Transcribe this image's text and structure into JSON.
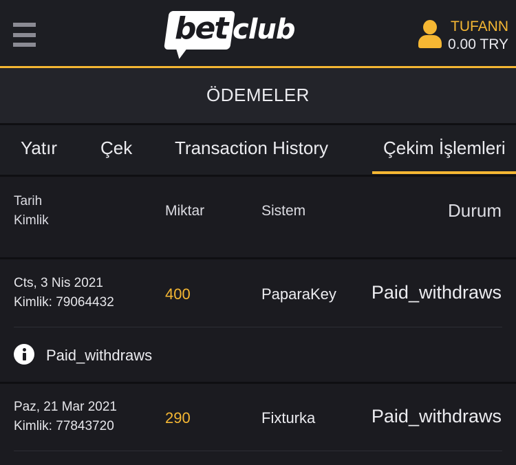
{
  "header": {
    "logo": {
      "part1": "bet",
      "part2": "club"
    },
    "username": "TUFANN",
    "balance": "0.00 TRY",
    "colors": {
      "accent": "#f5b733",
      "background": "#1b1b20"
    }
  },
  "page_title": "ÖDEMELER",
  "tabs": [
    {
      "label": "Yatır"
    },
    {
      "label": "Çek"
    },
    {
      "label": "Transaction History"
    },
    {
      "label": "Çekim İşlemleri",
      "active": true
    }
  ],
  "table": {
    "headers": {
      "date_line1": "Tarih",
      "date_line2": "Kimlik",
      "amount": "Miktar",
      "system": "Sistem",
      "status": "Durum"
    },
    "rows": [
      {
        "date": "Cts, 3 Nis 2021",
        "id": "Kimlik: 79064432",
        "amount": "400",
        "system": "PaparaKey",
        "status": "Paid_withdraws",
        "note": "Paid_withdraws"
      },
      {
        "date": "Paz, 21 Mar 2021",
        "id": "Kimlik: 77843720",
        "amount": "290",
        "system": "Fixturka",
        "status": "Paid_withdraws"
      }
    ]
  },
  "icons": [
    "hamburger-menu-icon",
    "user-icon",
    "info-icon"
  ]
}
